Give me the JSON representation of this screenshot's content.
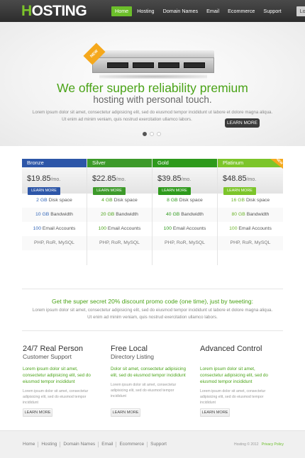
{
  "header": {
    "logo_first": "H",
    "logo_rest": "OSTING",
    "nav": [
      "Home",
      "Hosting",
      "Domain Names",
      "Email",
      "Ecommerce",
      "Support"
    ],
    "login": "Login"
  },
  "hero": {
    "ribbon": "NEW",
    "title": "We offer superb reliability premium",
    "subtitle": "hosting with personal touch.",
    "text_line1": "Lorem ipsum dolor sit amet, consectetur adipisicing elit, sed do eiusmod tempor incididunt ut labore et dolore magna aliqua.",
    "text_line2": "Ut enim ad minim veniam, quis nostrud exercitation ullamco labors.",
    "button": "LEARN MORE",
    "slides": 3,
    "active_slide": 1
  },
  "pricing": {
    "plans": [
      {
        "name": "Bronze",
        "price": "$19.85",
        "per": "/mo.",
        "button": "LEARN MORE",
        "color": "#2d56a8",
        "btn_color": "#2d56a8",
        "disk_num": "2 GB",
        "disk": "Disk space",
        "bw_num": "10 GB",
        "bw": "Bandwidth",
        "email_num": "100",
        "email": "Email Accounts",
        "tech": "PHP, RoR, MySQL"
      },
      {
        "name": "Silver",
        "price": "$22.85",
        "per": "/mo.",
        "button": "LEARN MORE",
        "color": "#3d9a2a",
        "btn_color": "#3d9a2a",
        "disk_num": "4 GB",
        "disk": "Disk space",
        "bw_num": "20 GB",
        "bw": "Bandwidth",
        "email_num": "100",
        "email": "Email Accounts",
        "tech": "PHP, RoR, MySQL"
      },
      {
        "name": "Gold",
        "price": "$39.85",
        "per": "/mo.",
        "button": "LEARN MORE",
        "color": "#2e9a1c",
        "btn_color": "#2e9a1c",
        "disk_num": "8 GB",
        "disk": "Disk space",
        "bw_num": "40 GB",
        "bw": "Bandwidth",
        "email_num": "100",
        "email": "Email Accounts",
        "tech": "PHP, RoR, MySQL"
      },
      {
        "name": "Platinum",
        "price": "$48.85",
        "per": "/mo.",
        "button": "LEARN MORE",
        "color": "#7cc52a",
        "btn_color": "#7cc52a",
        "disk_num": "16 GB",
        "disk": "Disk space",
        "bw_num": "80 GB",
        "bw": "Bandwidth",
        "email_num": "100",
        "email": "Email Accounts",
        "tech": "PHP, RoR, MySQL"
      }
    ],
    "new_badge": "NEW"
  },
  "promo": {
    "title": "Get the super secret 20% discount promo code (one time), just by tweeting:",
    "text_line1": "Lorem ipsum dolor sit amet, consectetur adipisicing elit, sed do eiusmod tempor incididunt ut labore et dolore magna aliqua.",
    "text_line2": "Ut enim ad minim veniam, quis nostrud exercitation ullamco labors."
  },
  "features": [
    {
      "title": "24/7 Real Person",
      "subtitle": "Customer Support",
      "green": "Lorem ipsum dolor sit amet, consectetur adipisicing elit, sed do eiusmod tempor incididunt",
      "text": "Lorem ipsum dolor sit amet, consectetur adipisicing elit, sed do eiusmod tempor incididunt",
      "button": "LEARN MORE"
    },
    {
      "title": "Free Local",
      "subtitle": "Directory Listing",
      "green": "Dolor sit amet, consectetur adipisicing elit, sed do eiusmod tempor incididunt",
      "text": "Lorem ipsum dolor sit amet, consectetur adipisicing elit, sed do eiusmod tempor incididunt",
      "button": "LEARN MORE"
    },
    {
      "title": "Advanced Control",
      "subtitle": "",
      "green": "Lorem ipsum dolor sit amet, consectetur adipisicing elit, sed do eiusmod tempor incididunt",
      "text": "Lorem ipsum dolor sit amet, consectetur adipisicing elit, sed do eiusmod tempor incididunt",
      "button": "LEARN MORE"
    }
  ],
  "footer": {
    "nav": [
      "Home",
      "Hosting",
      "Domain Names",
      "Email",
      "Ecommerce",
      "Support"
    ],
    "copyright": "Hosting © 2012",
    "policy": "Privacy Policy"
  }
}
